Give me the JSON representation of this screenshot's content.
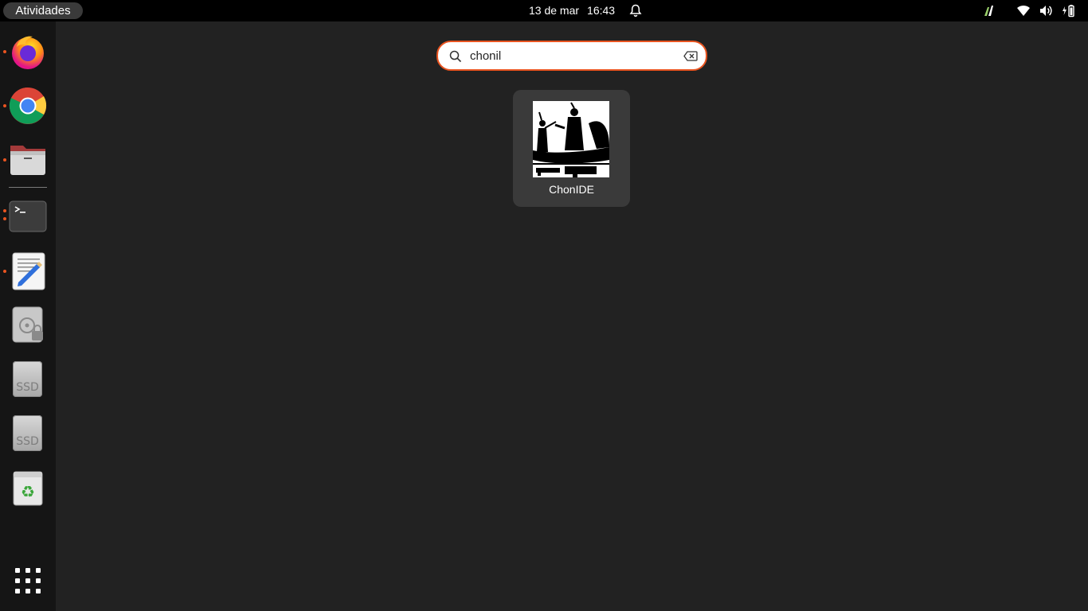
{
  "topbar": {
    "activities_label": "Atividades",
    "date": "13 de mar",
    "time": "16:43",
    "icons": [
      "notification-bell-icon",
      "performance-icon",
      "wifi-icon",
      "volume-icon",
      "battery-icon"
    ]
  },
  "dock": {
    "items": [
      {
        "name": "firefox",
        "icon": "firefox-icon",
        "running": true
      },
      {
        "name": "chrome",
        "icon": "chrome-icon",
        "running": true
      },
      {
        "name": "files",
        "icon": "folder-icon",
        "running": true
      },
      {
        "name": "terminal",
        "icon": "terminal-icon",
        "running": true
      },
      {
        "name": "text-editor",
        "icon": "text-editor-icon",
        "running": true
      },
      {
        "name": "disk",
        "icon": "disk-icon",
        "running": false
      },
      {
        "name": "ssd-1",
        "label": "SSD",
        "running": false
      },
      {
        "name": "ssd-2",
        "label": "SSD",
        "running": false
      },
      {
        "name": "trash",
        "icon": "trash-icon",
        "running": false
      }
    ],
    "show_apps_icon": "app-grid-icon"
  },
  "search": {
    "value": "chonil",
    "icon": "search-icon",
    "clear_icon": "clear-icon"
  },
  "results": [
    {
      "label": "ChonIDE",
      "icon": "chonide-app-icon"
    }
  ],
  "colors": {
    "accent": "#e95420",
    "background": "#222222",
    "dock": "#151515",
    "topbar": "#000000",
    "tile": "#3a3a3a"
  }
}
